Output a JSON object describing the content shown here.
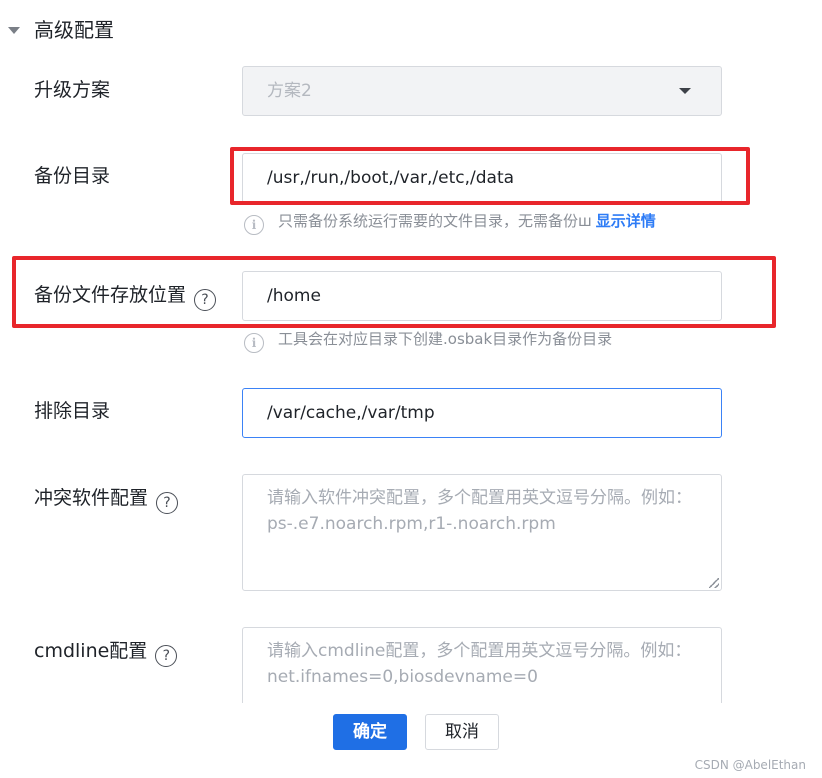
{
  "section": {
    "title": "高级配置",
    "expanded": true
  },
  "fields": {
    "upgrade_plan": {
      "label": "升级方案",
      "value": "方案2",
      "disabled": true
    },
    "backup_dir": {
      "label": "备份目录",
      "value": "/usr,/run,/boot,/var,/etc,/data",
      "hint": "只需备份系统运行需要的文件目录，无需备份ш",
      "hint_link": "显示详情"
    },
    "backup_location": {
      "label": "备份文件存放位置",
      "value": "/home",
      "hint": "工具会在对应目录下创建.osbak目录作为备份目录"
    },
    "exclude_dir": {
      "label": "排除目录",
      "value": "/var/cache,/var/tmp"
    },
    "conflict_software": {
      "label": "冲突软件配置",
      "placeholder": "请输入软件冲突配置，多个配置用英文逗号分隔。例如：ps-.e7.noarch.rpm,r1-.noarch.rpm"
    },
    "cmdline": {
      "label": "cmdline配置",
      "placeholder": "请输入cmdline配置，多个配置用英文逗号分隔。例如：net.ifnames=0,biosdevname=0"
    }
  },
  "icons": {
    "help": "?",
    "info": "i"
  },
  "buttons": {
    "confirm": "确定",
    "cancel": "取消"
  },
  "watermark": "CSDN @AbelEthan",
  "colors": {
    "highlight": "#e8262b",
    "primary": "#1f6fe5",
    "link": "#2e7cf6",
    "active_border": "#3b82f6"
  }
}
